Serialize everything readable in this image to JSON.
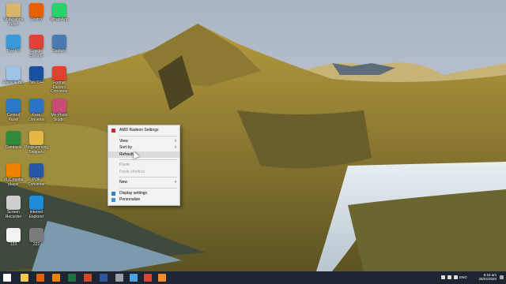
{
  "desktop_icons": [
    {
      "label": "Shrikrishna Palan",
      "icon": "user-folder-icon",
      "color": "#d9b66d"
    },
    {
      "label": "Firefox",
      "icon": "firefox-icon",
      "color": "#e66000"
    },
    {
      "label": "WhatsApp",
      "icon": "whatsapp-icon",
      "color": "#25d366"
    },
    {
      "label": "This PC",
      "icon": "this-pc-icon",
      "color": "#3a9ad9"
    },
    {
      "label": "Google Chrome",
      "icon": "chrome-icon",
      "color": "#db4437"
    },
    {
      "label": "Capture",
      "icon": "capture-icon",
      "color": "#4a7ab0"
    },
    {
      "label": "Recycle Bin",
      "icon": "recycle-bin-icon",
      "color": "#9cc4e4"
    },
    {
      "label": "Dev C++",
      "icon": "devcpp-icon",
      "color": "#1b4fa0"
    },
    {
      "label": "Format Factory Converter",
      "icon": "format-factory-icon",
      "color": "#e0412c"
    },
    {
      "label": "Control Panel",
      "icon": "control-panel-icon",
      "color": "#2a78c8"
    },
    {
      "label": "Free Converter",
      "icon": "free-converter-icon",
      "color": "#2b73c9"
    },
    {
      "label": "My Photo Studio",
      "icon": "photo-studio-icon",
      "color": "#c94b7a"
    },
    {
      "label": "Camtasia",
      "icon": "camtasia-icon",
      "color": "#2f8a3c"
    },
    {
      "label": "Programming Snippets",
      "icon": "folder-icon",
      "color": "#e3b845"
    },
    {
      "label": "VLC media player",
      "icon": "vlc-icon",
      "color": "#ef8200"
    },
    {
      "label": "PDF Converter",
      "icon": "pdf-converter-icon",
      "color": "#2559a8"
    },
    {
      "label": "Screen Recorder",
      "icon": "screen-recorder-icon",
      "color": "#cfcfcf"
    },
    {
      "label": "Internet Explorer",
      "icon": "ie-icon",
      "color": "#1e8bd8"
    },
    {
      "label": "123",
      "icon": "document-icon",
      "color": "#f2f2f2"
    },
    {
      "label": "222",
      "icon": "archive-icon",
      "color": "#7a7a7a"
    }
  ],
  "context_menu": {
    "header": "AMD Radeon Settings",
    "view": "View",
    "sort_by": "Sort by",
    "refresh": "Refresh",
    "paste": "Paste",
    "paste_shortcut": "Paste shortcut",
    "new": "New",
    "display_settings": "Display settings",
    "personalize": "Personalize"
  },
  "taskbar": {
    "apps": [
      {
        "icon": "start-icon",
        "color": "#ffffff"
      },
      {
        "icon": "file-explorer-icon",
        "color": "#f2c94c"
      },
      {
        "icon": "firefox-taskbar-icon",
        "color": "#e66000"
      },
      {
        "icon": "vlc-taskbar-icon",
        "color": "#ef8200"
      },
      {
        "icon": "excel-icon",
        "color": "#1f7244"
      },
      {
        "icon": "powerpoint-icon",
        "color": "#d24726"
      },
      {
        "icon": "word-icon",
        "color": "#2b579a"
      },
      {
        "icon": "settings-icon",
        "color": "#9aa0a6"
      },
      {
        "icon": "snipping-icon",
        "color": "#4aa3df"
      },
      {
        "icon": "chrome-taskbar-icon",
        "color": "#db4437"
      },
      {
        "icon": "sublime-icon",
        "color": "#f28b30"
      }
    ],
    "language": "ENG",
    "time": "8:16 am",
    "date": "26/04/2020"
  }
}
